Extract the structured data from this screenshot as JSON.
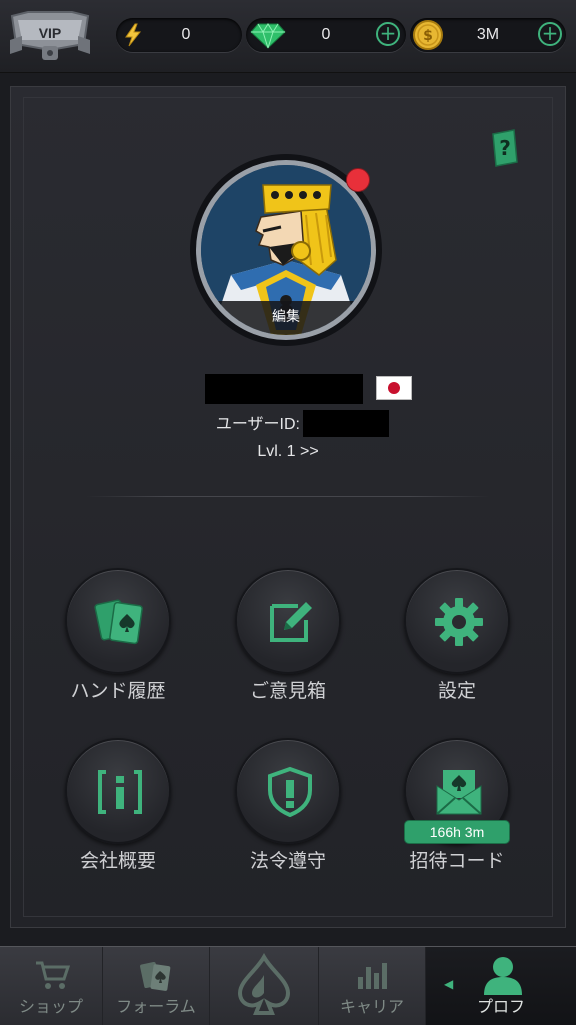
{
  "topbar": {
    "vip_label": "VIP",
    "energy_value": "0",
    "gem_value": "0",
    "coin_value": "3M",
    "plus_symbol": "+"
  },
  "profile": {
    "edit_label": "編集",
    "user_id_label": "ユーザーID:",
    "level_text": "Lvl. 1 >>"
  },
  "menu": {
    "items": [
      {
        "label": "ハンド履歴",
        "icon": "cards-icon"
      },
      {
        "label": "ご意見箱",
        "icon": "pencil-edit-icon"
      },
      {
        "label": "設定",
        "icon": "gear-icon"
      },
      {
        "label": "会社概要",
        "icon": "info-icon"
      },
      {
        "label": "法令遵守",
        "icon": "shield-alert-icon"
      },
      {
        "label": "招待コード",
        "icon": "envelope-spade-icon"
      }
    ],
    "invite_timer": "166h  3m"
  },
  "bottomnav": {
    "items": [
      {
        "label": "ショップ",
        "icon": "cart-icon"
      },
      {
        "label": "フォーラム",
        "icon": "cards-icon"
      },
      {
        "label": "",
        "icon": "spade-logo-icon"
      },
      {
        "label": "キャリア",
        "icon": "bar-chart-icon"
      },
      {
        "label": "プロフ",
        "icon": "person-icon"
      }
    ],
    "active_index": 4
  },
  "colors": {
    "accent_green": "#3fb37d",
    "notification_red": "#e8303a",
    "background": "#1b1c20"
  }
}
